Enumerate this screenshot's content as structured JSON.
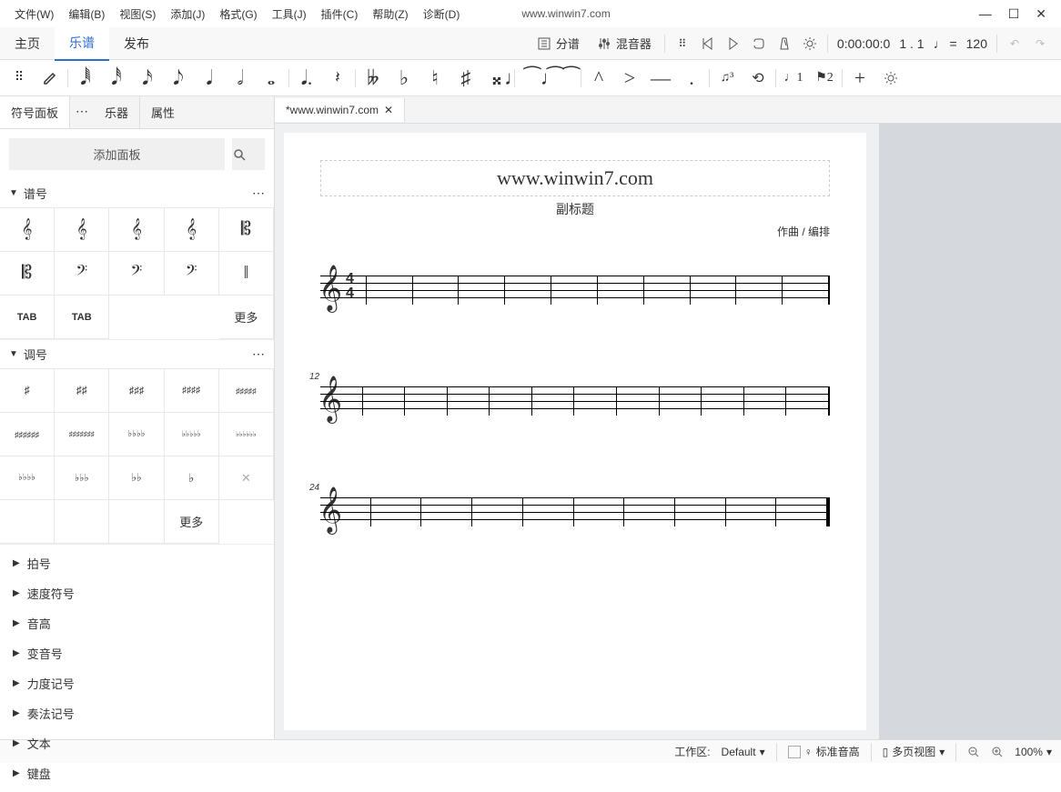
{
  "menu": {
    "file": "文件(W)",
    "edit": "编辑(B)",
    "view": "视图(S)",
    "add": "添加(J)",
    "format": "格式(G)",
    "tools": "工具(J)",
    "plugins": "插件(C)",
    "help": "帮助(Z)",
    "diag": "诊断(D)"
  },
  "title_url": "www.winwin7.com",
  "main_tabs": {
    "home": "主页",
    "score": "乐谱",
    "publish": "发布"
  },
  "toolbar": {
    "parts": "分谱",
    "mixer": "混音器",
    "time": "0:00:00:0",
    "pos": "1 . 1",
    "tempo_note": "♩ =",
    "tempo": "120"
  },
  "panel_tabs": {
    "palette": "符号面板",
    "instrument": "乐器",
    "properties": "属性"
  },
  "search": {
    "add_panel": "添加面板"
  },
  "sections": {
    "clefs": {
      "title": "谱号",
      "more": "更多"
    },
    "keysig": {
      "title": "调号",
      "more": "更多"
    },
    "collapsed": [
      "拍号",
      "速度符号",
      "音高",
      "变音号",
      "力度记号",
      "奏法记号",
      "文本",
      "键盘"
    ]
  },
  "clef_cells": [
    "𝄞",
    "𝄞",
    "𝄞",
    "𝄞",
    "𝄡",
    "𝄡",
    "𝄢",
    "𝄢",
    "𝄢",
    "‖",
    "TAB",
    "TAB"
  ],
  "key_cells": [
    "♯",
    "♯♯",
    "♯♯♯",
    "♯♯♯♯",
    "♯♯♯♯♯",
    "♯♯♯♯♯♯",
    "♯♯♯♯♯♯♯",
    "♭♭♭♭",
    "♭♭♭♭♭",
    "♭♭♭♭♭♭",
    "♭♭♭♭",
    "♭♭♭",
    "♭♭",
    "♭",
    "✕"
  ],
  "doc_tab": {
    "name": "*www.winwin7.com"
  },
  "score": {
    "title": "www.winwin7.com",
    "subtitle": "副标题",
    "composer": "作曲 / 编排",
    "measure12": "12",
    "measure24": "24",
    "timesig_top": "4",
    "timesig_bot": "4"
  },
  "statusbar": {
    "workspace_label": "工作区:",
    "workspace": "Default",
    "concert": "标准音高",
    "view": "多页视图",
    "zoom": "100%"
  }
}
